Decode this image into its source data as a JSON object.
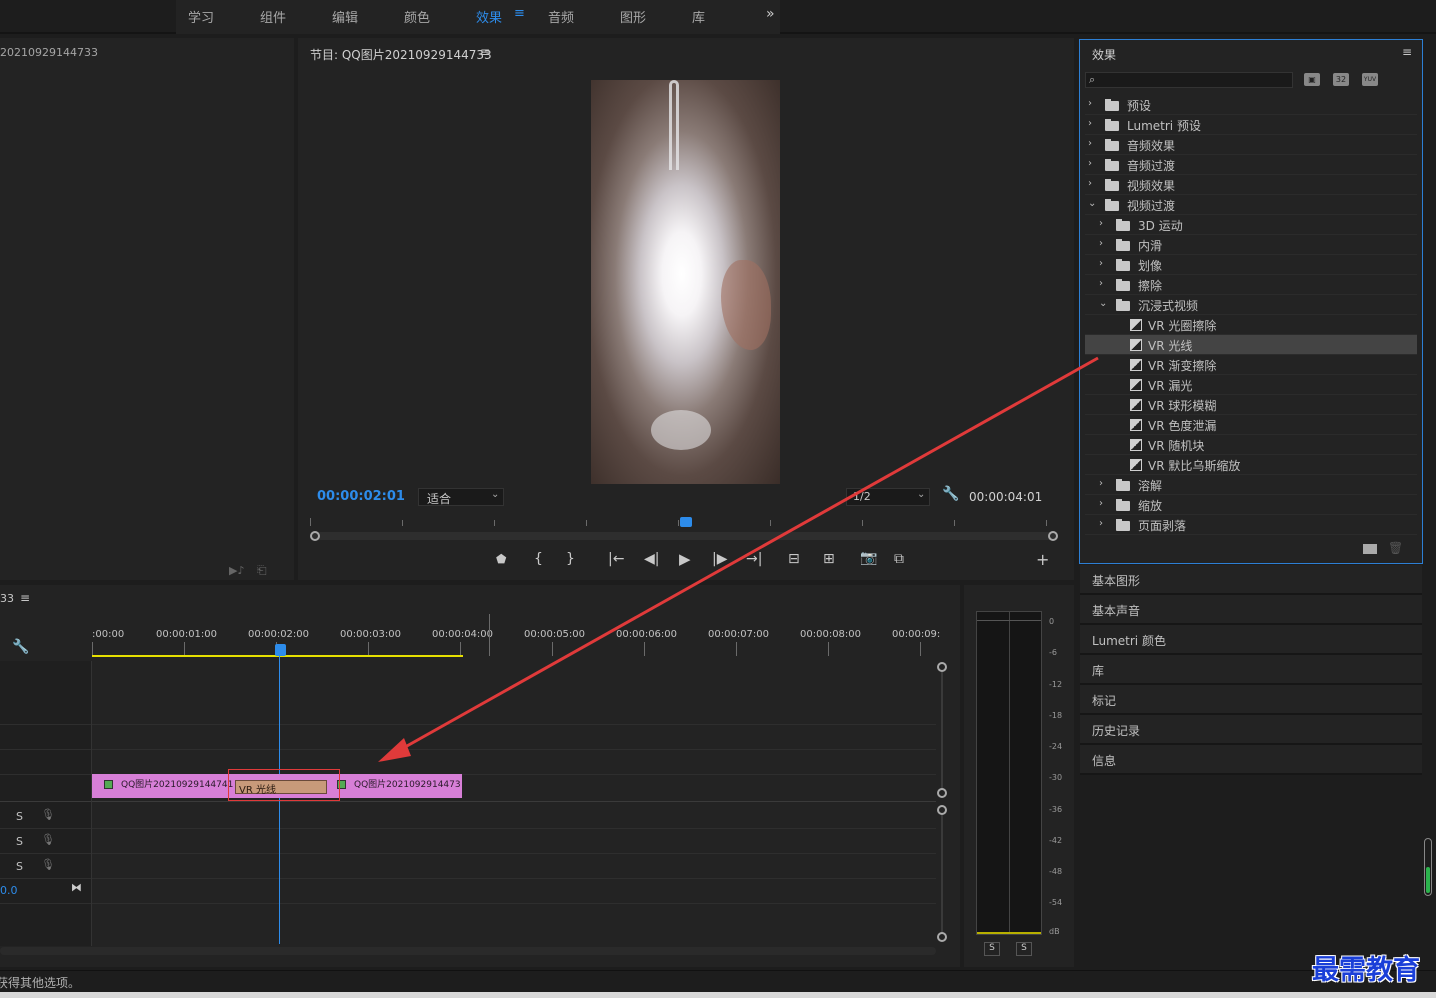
{
  "workspace_tabs": [
    "学习",
    "组件",
    "编辑",
    "颜色",
    "效果",
    "音频",
    "图形",
    "库"
  ],
  "workspace_active_index": 4,
  "workspace_more": "»",
  "source_panel": {
    "title": "20210929144733"
  },
  "program_monitor": {
    "title": "节目: QQ图片20210929144733",
    "menu_icon": "≡",
    "timecode_current": "00:00:02:01",
    "zoom": "适合",
    "resolution": "1/2",
    "timecode_duration": "00:00:04:01"
  },
  "effects_panel": {
    "title": "效果",
    "menu_icon": "≡",
    "search_placeholder": "",
    "badges": [
      "32",
      "YUV"
    ],
    "tree": [
      {
        "label": "预设",
        "level": 0,
        "kind": "preset-folder",
        "expanded": false
      },
      {
        "label": "Lumetri 预设",
        "level": 0,
        "kind": "preset-folder",
        "expanded": false
      },
      {
        "label": "音频效果",
        "level": 0,
        "kind": "folder",
        "expanded": false
      },
      {
        "label": "音频过渡",
        "level": 0,
        "kind": "folder",
        "expanded": false
      },
      {
        "label": "视频效果",
        "level": 0,
        "kind": "folder",
        "expanded": false
      },
      {
        "label": "视频过渡",
        "level": 0,
        "kind": "folder",
        "expanded": true
      },
      {
        "label": "3D 运动",
        "level": 1,
        "kind": "folder",
        "expanded": false
      },
      {
        "label": "内滑",
        "level": 1,
        "kind": "folder",
        "expanded": false
      },
      {
        "label": "划像",
        "level": 1,
        "kind": "folder",
        "expanded": false
      },
      {
        "label": "擦除",
        "level": 1,
        "kind": "folder",
        "expanded": false
      },
      {
        "label": "沉浸式视频",
        "level": 1,
        "kind": "folder",
        "expanded": true
      },
      {
        "label": "VR 光圈擦除",
        "level": 2,
        "kind": "effect"
      },
      {
        "label": "VR 光线",
        "level": 2,
        "kind": "effect",
        "selected": true
      },
      {
        "label": "VR 渐变擦除",
        "level": 2,
        "kind": "effect"
      },
      {
        "label": "VR 漏光",
        "level": 2,
        "kind": "effect"
      },
      {
        "label": "VR 球形模糊",
        "level": 2,
        "kind": "effect"
      },
      {
        "label": "VR 色度泄漏",
        "level": 2,
        "kind": "effect"
      },
      {
        "label": "VR 随机块",
        "level": 2,
        "kind": "effect"
      },
      {
        "label": "VR 默比乌斯缩放",
        "level": 2,
        "kind": "effect"
      },
      {
        "label": "溶解",
        "level": 1,
        "kind": "folder",
        "expanded": false
      },
      {
        "label": "缩放",
        "level": 1,
        "kind": "folder",
        "expanded": false
      },
      {
        "label": "页面剥落",
        "level": 1,
        "kind": "folder",
        "expanded": false
      }
    ]
  },
  "side_panels": [
    "基本图形",
    "基本声音",
    "Lumetri 颜色",
    "库",
    "标记",
    "历史记录",
    "信息"
  ],
  "timeline": {
    "title": "33",
    "menu_icon": "≡",
    "ruler": [
      ":00:00",
      "00:00:01:00",
      "00:00:02:00",
      "00:00:03:00",
      "00:00:04:00",
      "00:00:05:00",
      "00:00:06:00",
      "00:00:07:00",
      "00:00:08:00",
      "00:00:09:"
    ],
    "clip_a": "QQ图片20210929144741",
    "clip_b": "QQ图片2021092914473",
    "transition": "VR 光线",
    "audio_track_s": [
      "S",
      "S",
      "S"
    ],
    "master_value": "0.0"
  },
  "audio_meter": {
    "scale": [
      "0",
      "-6",
      "-12",
      "-18",
      "-24",
      "-30",
      "-36",
      "-42",
      "-48",
      "-54",
      "dB"
    ],
    "solo_buttons": [
      "S",
      "S"
    ]
  },
  "status_bar": "获得其他选项。",
  "watermark": "最需教育",
  "colors": {
    "accent": "#2d8ceb",
    "clip": "#d77fd7",
    "transition": "#c89a7a",
    "arrow": "#e03a3a",
    "panel_outline": "#2d7fd4"
  }
}
